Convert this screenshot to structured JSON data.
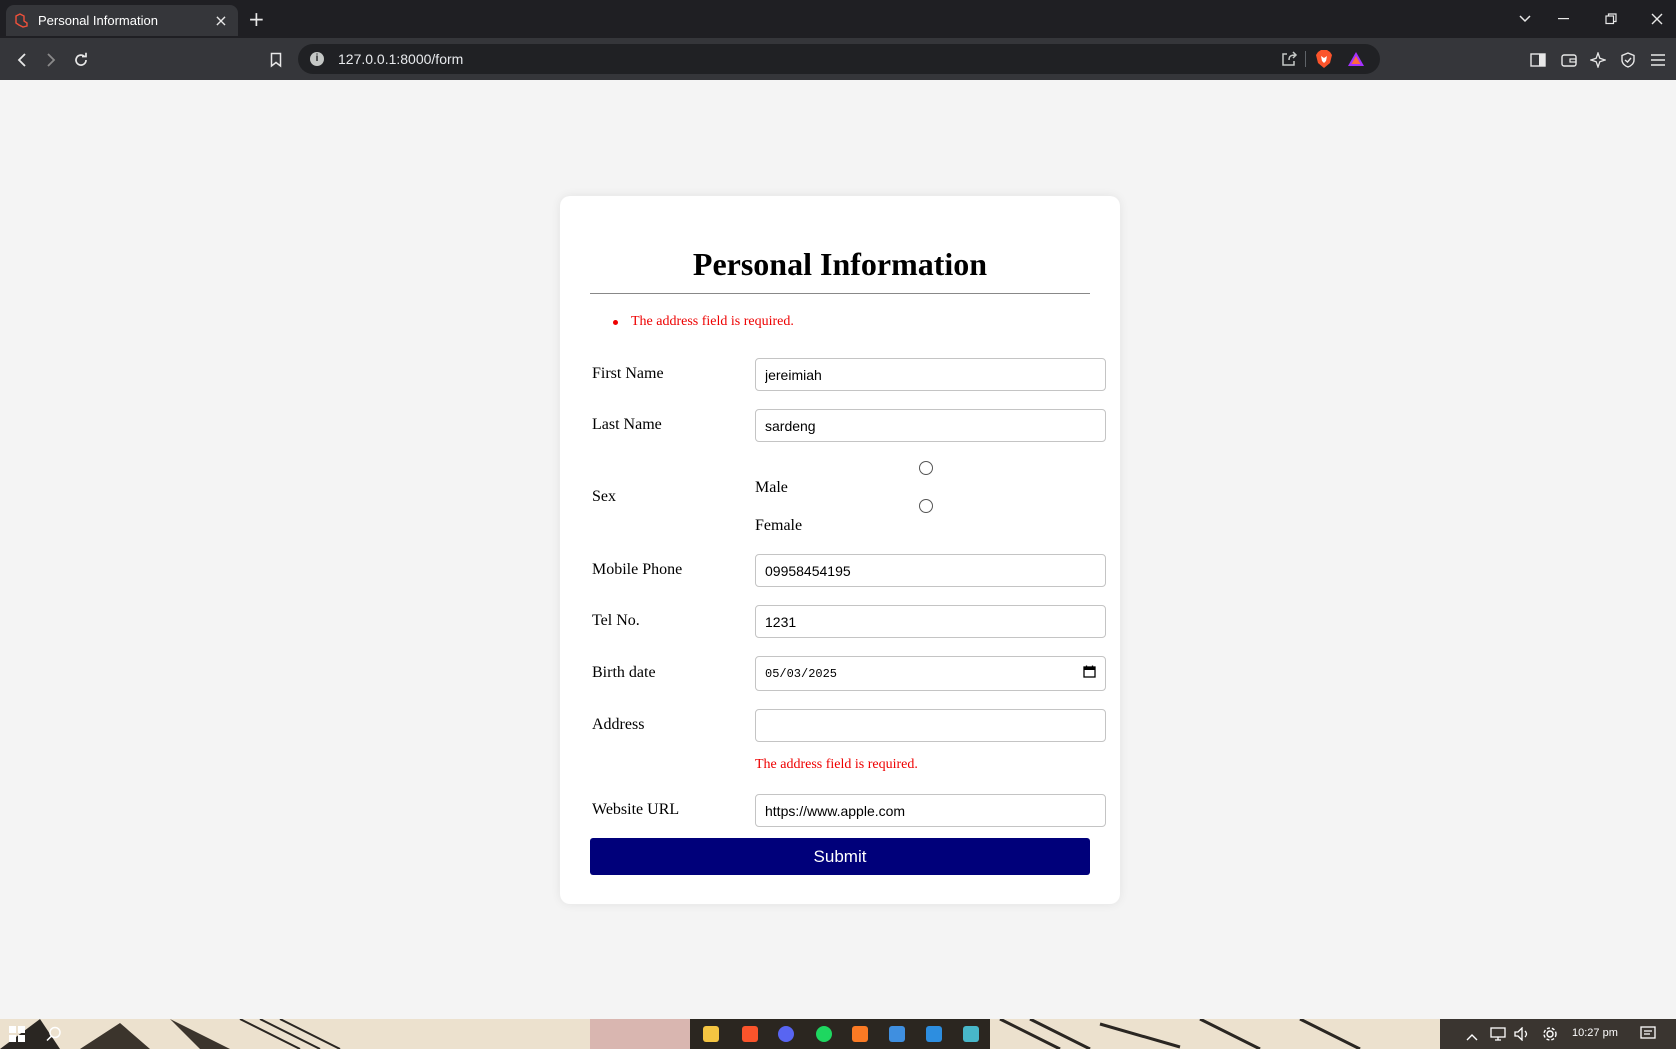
{
  "browser": {
    "tab_title": "Personal Information",
    "tab_close": "×",
    "new_tab": "+",
    "url": "127.0.0.1:8000/form",
    "accent": "#ffffff",
    "brave_color": "#fb542b"
  },
  "form": {
    "title": "Personal Information",
    "errors": [
      "The address field is required."
    ],
    "fields": {
      "first_name": {
        "label": "First Name",
        "value": "jereimiah"
      },
      "last_name": {
        "label": "Last Name",
        "value": "sardeng"
      },
      "sex": {
        "label": "Sex",
        "options": [
          "Male",
          "Female"
        ],
        "selected": null
      },
      "mobile_phone": {
        "label": "Mobile Phone",
        "value": "09958454195"
      },
      "tel_no": {
        "label": "Tel No.",
        "value": "1231"
      },
      "birth_date": {
        "label": "Birth date",
        "value": "05/03/2025"
      },
      "address": {
        "label": "Address",
        "value": "",
        "error": "The address field is required."
      },
      "website_url": {
        "label": "Website URL",
        "value": "https://www.apple.com"
      }
    },
    "submit_label": "Submit",
    "submit_color": "#00007a",
    "error_color": "#ee0000"
  },
  "taskbar": {
    "time": "10:27 pm",
    "icons": [
      "file-explorer-icon",
      "brave-icon",
      "discord-icon",
      "spotify-icon",
      "xampp-icon",
      "notepad-icon",
      "vscode-icon",
      "network-tool-icon"
    ]
  }
}
